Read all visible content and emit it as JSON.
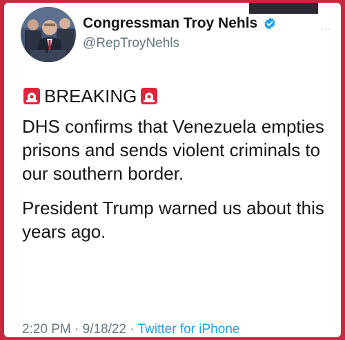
{
  "tweet": {
    "author": {
      "name": "Congressman Troy Nehls",
      "handle": "@RepTroyNehls",
      "verified_color": "#1da1f2"
    },
    "text": {
      "headline": "BREAKING",
      "paragraph_1": "DHS confirms that Venezuela empties prisons and sends violent criminals to our southern border.",
      "paragraph_2": "President Trump warned us about this years ago."
    },
    "meta": {
      "time": "2:20 PM",
      "date": "9/18/22",
      "separator": "·",
      "source": "Twitter for iPhone"
    },
    "more_label": "···"
  },
  "colors": {
    "frame": "#c9293f",
    "card": "#ffffff",
    "text": "#14171a",
    "muted": "#657786",
    "link": "#1da1f2",
    "siren": "#e0243b"
  },
  "icons": [
    "avatar-photo",
    "verified-badge-icon",
    "siren-icon",
    "more-icon"
  ]
}
